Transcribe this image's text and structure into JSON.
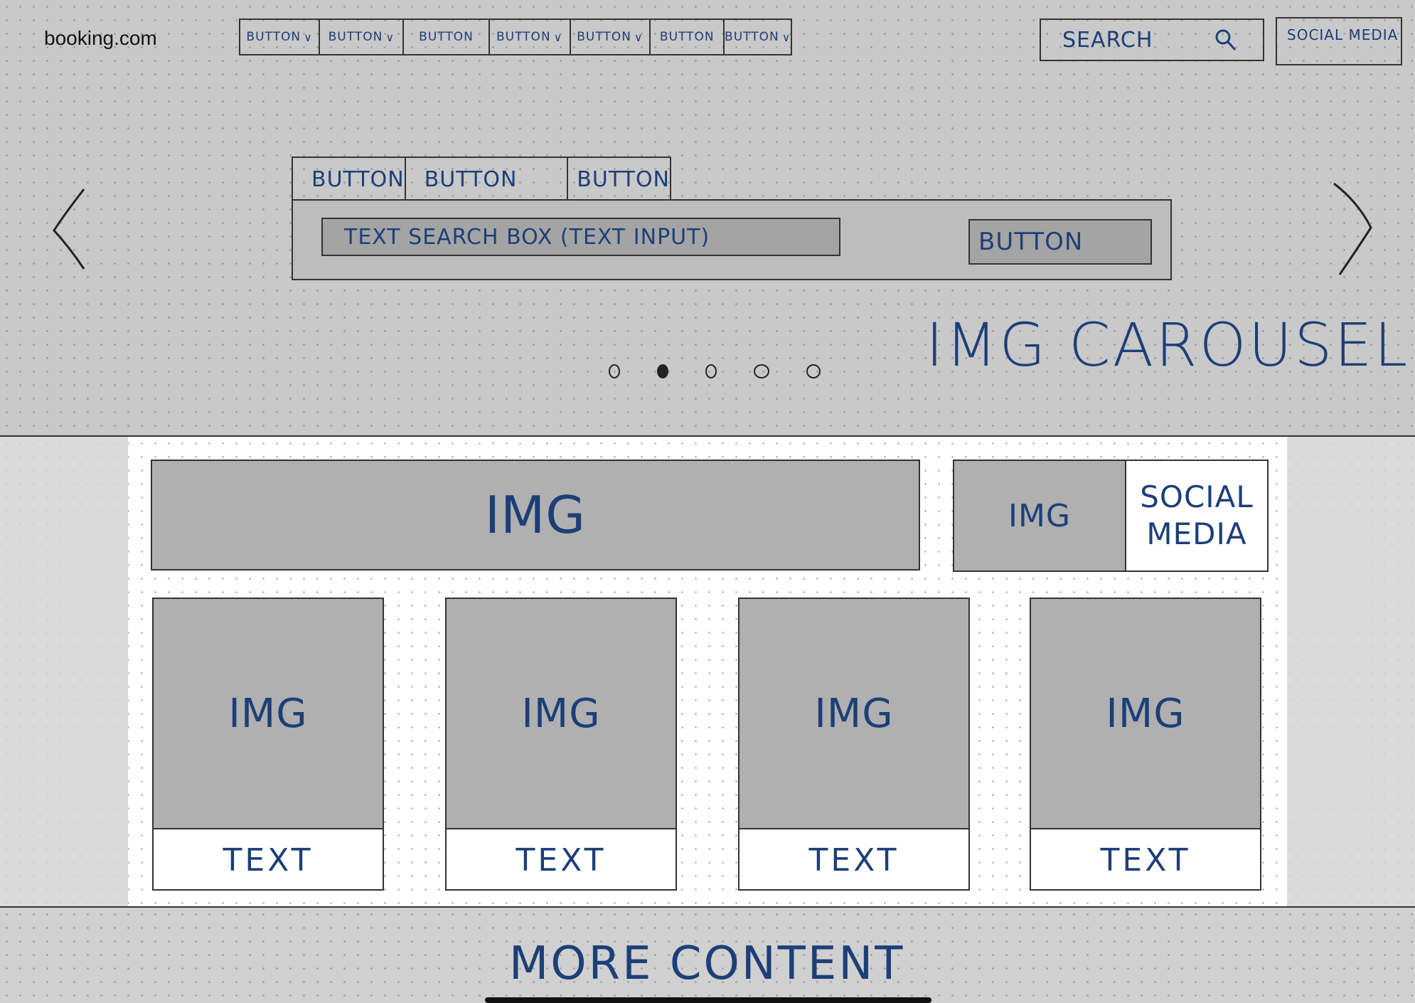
{
  "header": {
    "logo": "booking.com",
    "nav": [
      {
        "label": "Button",
        "dropdown": true
      },
      {
        "label": "Button",
        "dropdown": true
      },
      {
        "label": "Button",
        "dropdown": false
      },
      {
        "label": "Button",
        "dropdown": true
      },
      {
        "label": "Button",
        "dropdown": true
      },
      {
        "label": "Button",
        "dropdown": false
      },
      {
        "label": "Button",
        "dropdown": true
      }
    ],
    "search_label": "Search",
    "social_label": "Social Media"
  },
  "hero": {
    "tabs": [
      "Button",
      "Button",
      "Button"
    ],
    "search_input_placeholder": "Text Search Box (Text Input)",
    "search_button": "Button",
    "carousel_label": "IMG Carousel",
    "carousel_dots": 5,
    "active_dot": 1
  },
  "main": {
    "banner": "IMG",
    "social_card": {
      "img": "IMG",
      "label": "Social Media"
    },
    "cards": [
      {
        "img": "IMG",
        "text": "Text"
      },
      {
        "img": "IMG",
        "text": "Text"
      },
      {
        "img": "IMG",
        "text": "Text"
      },
      {
        "img": "IMG",
        "text": "Text"
      }
    ]
  },
  "footer": {
    "label": "More Content"
  },
  "icons": {
    "search": "search-icon",
    "prev": "chevron-left-icon",
    "next": "chevron-right-icon"
  }
}
